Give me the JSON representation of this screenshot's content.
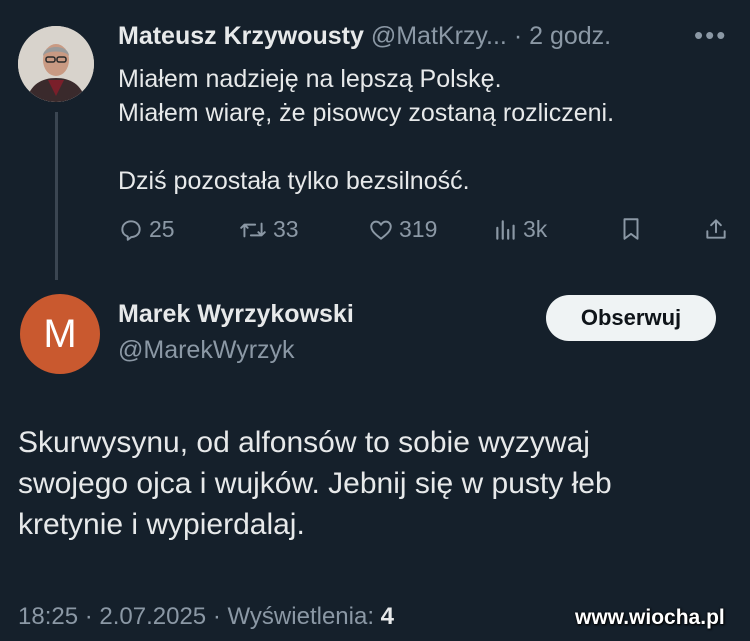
{
  "tweet1": {
    "author_name": "Mateusz Krzywousty",
    "author_handle": "@MatKrzy...",
    "separator": "·",
    "time": "2 godz.",
    "more_label": "•••",
    "lines": [
      "Miałem nadzieję na lepszą Polskę.",
      "Miałem wiarę, że pisowcy zostaną rozliczeni.",
      "",
      "Dziś pozostała tylko bezsilność."
    ],
    "stats": {
      "replies": "25",
      "retweets": "33",
      "likes": "319",
      "views": "3k"
    }
  },
  "tweet2": {
    "avatar_letter": "M",
    "author_name": "Marek Wyrzykowski",
    "author_handle": "@MarekWyrzyk",
    "follow_label": "Obserwuj",
    "lines": [
      "Skurwysynu, od alfonsów to sobie wyzywaj",
      "swojego ojca i wujków. Jebnij się w pusty łeb",
      "kretynie i wypierdalaj."
    ],
    "meta_prefix": "18:25 · 2.07.2025 · Wyświetlenia: ",
    "views_count": "4"
  },
  "watermark": "www.wiocha.pl",
  "colors": {
    "background": "#15202b",
    "text": "#e7e9ea",
    "secondary": "#8b98a5",
    "avatar2": "#c9592f",
    "follow_button": "#eff3f4"
  },
  "icons": [
    "reply-icon",
    "retweet-icon",
    "like-icon",
    "views-icon",
    "bookmark-icon",
    "share-icon"
  ]
}
